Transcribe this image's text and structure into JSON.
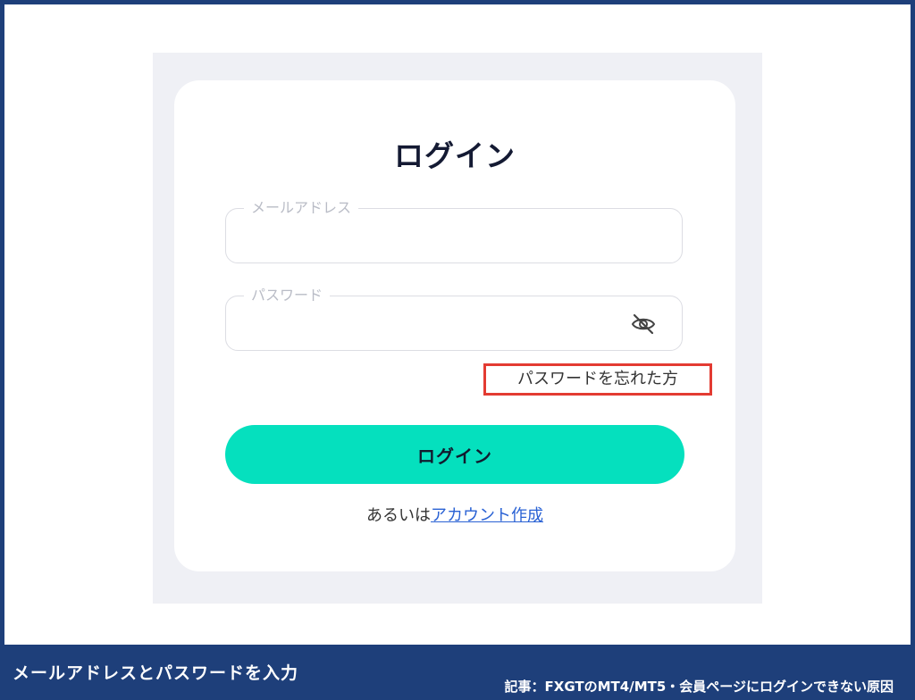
{
  "login_form": {
    "title": "ログイン",
    "email": {
      "label": "メールアドレス",
      "value": ""
    },
    "password": {
      "label": "パスワード",
      "value": "",
      "visibility_icon": "eye-slash-icon"
    },
    "forgot_password_label": "パスワードを忘れた方",
    "login_button_label": "ログイン",
    "signup_prefix": "あるいは",
    "signup_link_label": "アカウント作成"
  },
  "caption": {
    "left": "メールアドレスとパスワードを入力",
    "right": "記事：FXGTのMT4/MT5・会員ページにログインできない原因"
  },
  "colors": {
    "accent_button": "#05e0be",
    "highlight_border": "#e33b32",
    "link": "#2a62d4",
    "frame": "#1e3f7a"
  }
}
